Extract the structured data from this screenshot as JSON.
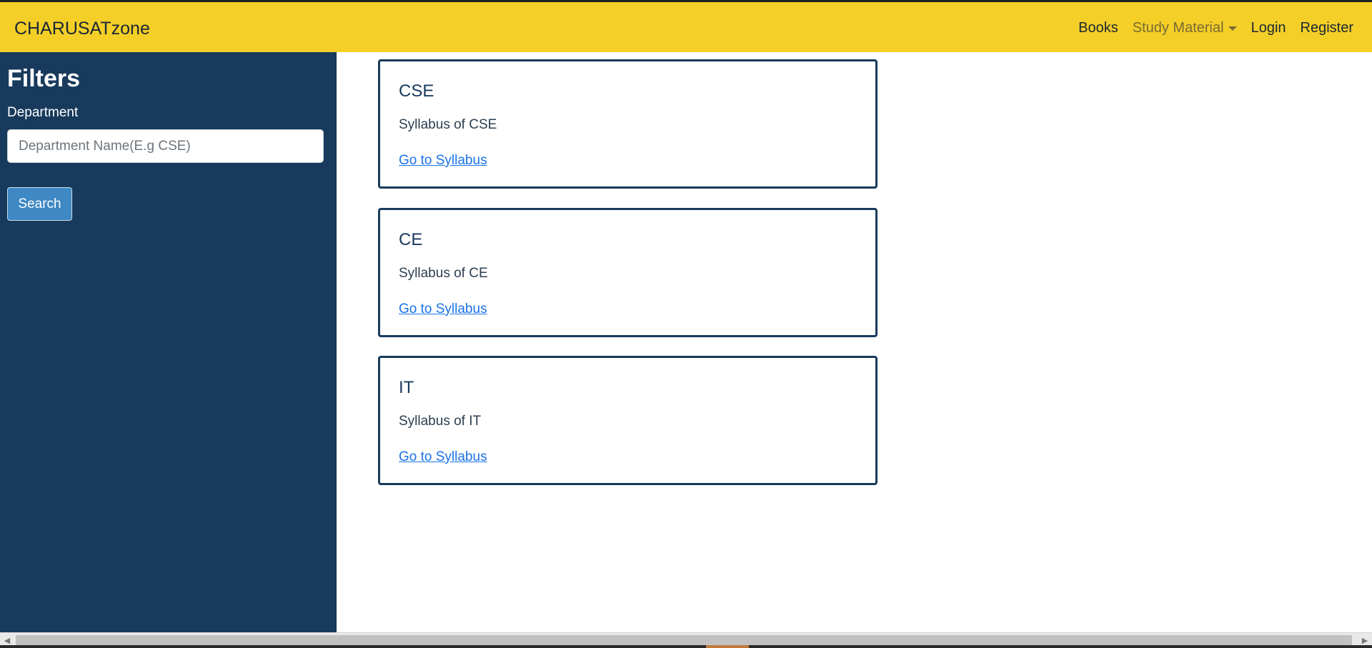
{
  "header": {
    "brand": "CHARUSATzone",
    "nav": {
      "books": "Books",
      "study_material": "Study Material",
      "login": "Login",
      "register": "Register"
    }
  },
  "sidebar": {
    "title": "Filters",
    "department_label": "Department",
    "department_placeholder": "Department Name(E.g CSE)",
    "search_label": "Search"
  },
  "cards": [
    {
      "title": "CSE",
      "text": "Syllabus of CSE",
      "link": "Go to Syllabus"
    },
    {
      "title": "CE",
      "text": "Syllabus of CE",
      "link": "Go to Syllabus"
    },
    {
      "title": "IT",
      "text": "Syllabus of IT",
      "link": "Go to Syllabus"
    }
  ],
  "colors": {
    "navbar": "#f3cf28",
    "sidebar": "#183a5c",
    "button": "#3e88c3",
    "link": "#1a73e8"
  },
  "icons": {
    "dropdown": "caret-down-icon",
    "scroll_left": "scroll-left-arrow-icon",
    "scroll_right": "scroll-right-arrow-icon"
  }
}
